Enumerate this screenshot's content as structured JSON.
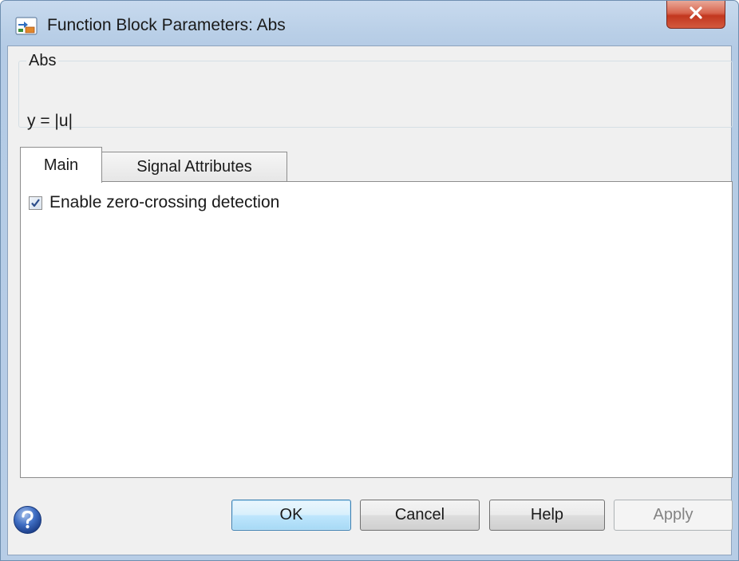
{
  "window": {
    "title": "Function Block Parameters: Abs",
    "close_symbol": "X",
    "icons": [
      "simulink-block-icon",
      "close-icon",
      "help-icon"
    ]
  },
  "description": {
    "group_label": "Abs",
    "text": "y = |u|"
  },
  "tabs": [
    {
      "label": "Main",
      "active": true
    },
    {
      "label": "Signal Attributes",
      "active": false
    }
  ],
  "main_tab": {
    "zero_crossing": {
      "label": "Enable zero-crossing detection",
      "checked": true
    }
  },
  "buttons": {
    "ok": "OK",
    "cancel": "Cancel",
    "help": "Help",
    "apply": "Apply",
    "apply_enabled": false
  },
  "colors": {
    "title_bar": "#b9cfe7",
    "close_button": "#c2371f",
    "dialog_background": "#f0f0f0",
    "default_button_border": "#3c7fb1",
    "disabled_text": "#838383"
  }
}
